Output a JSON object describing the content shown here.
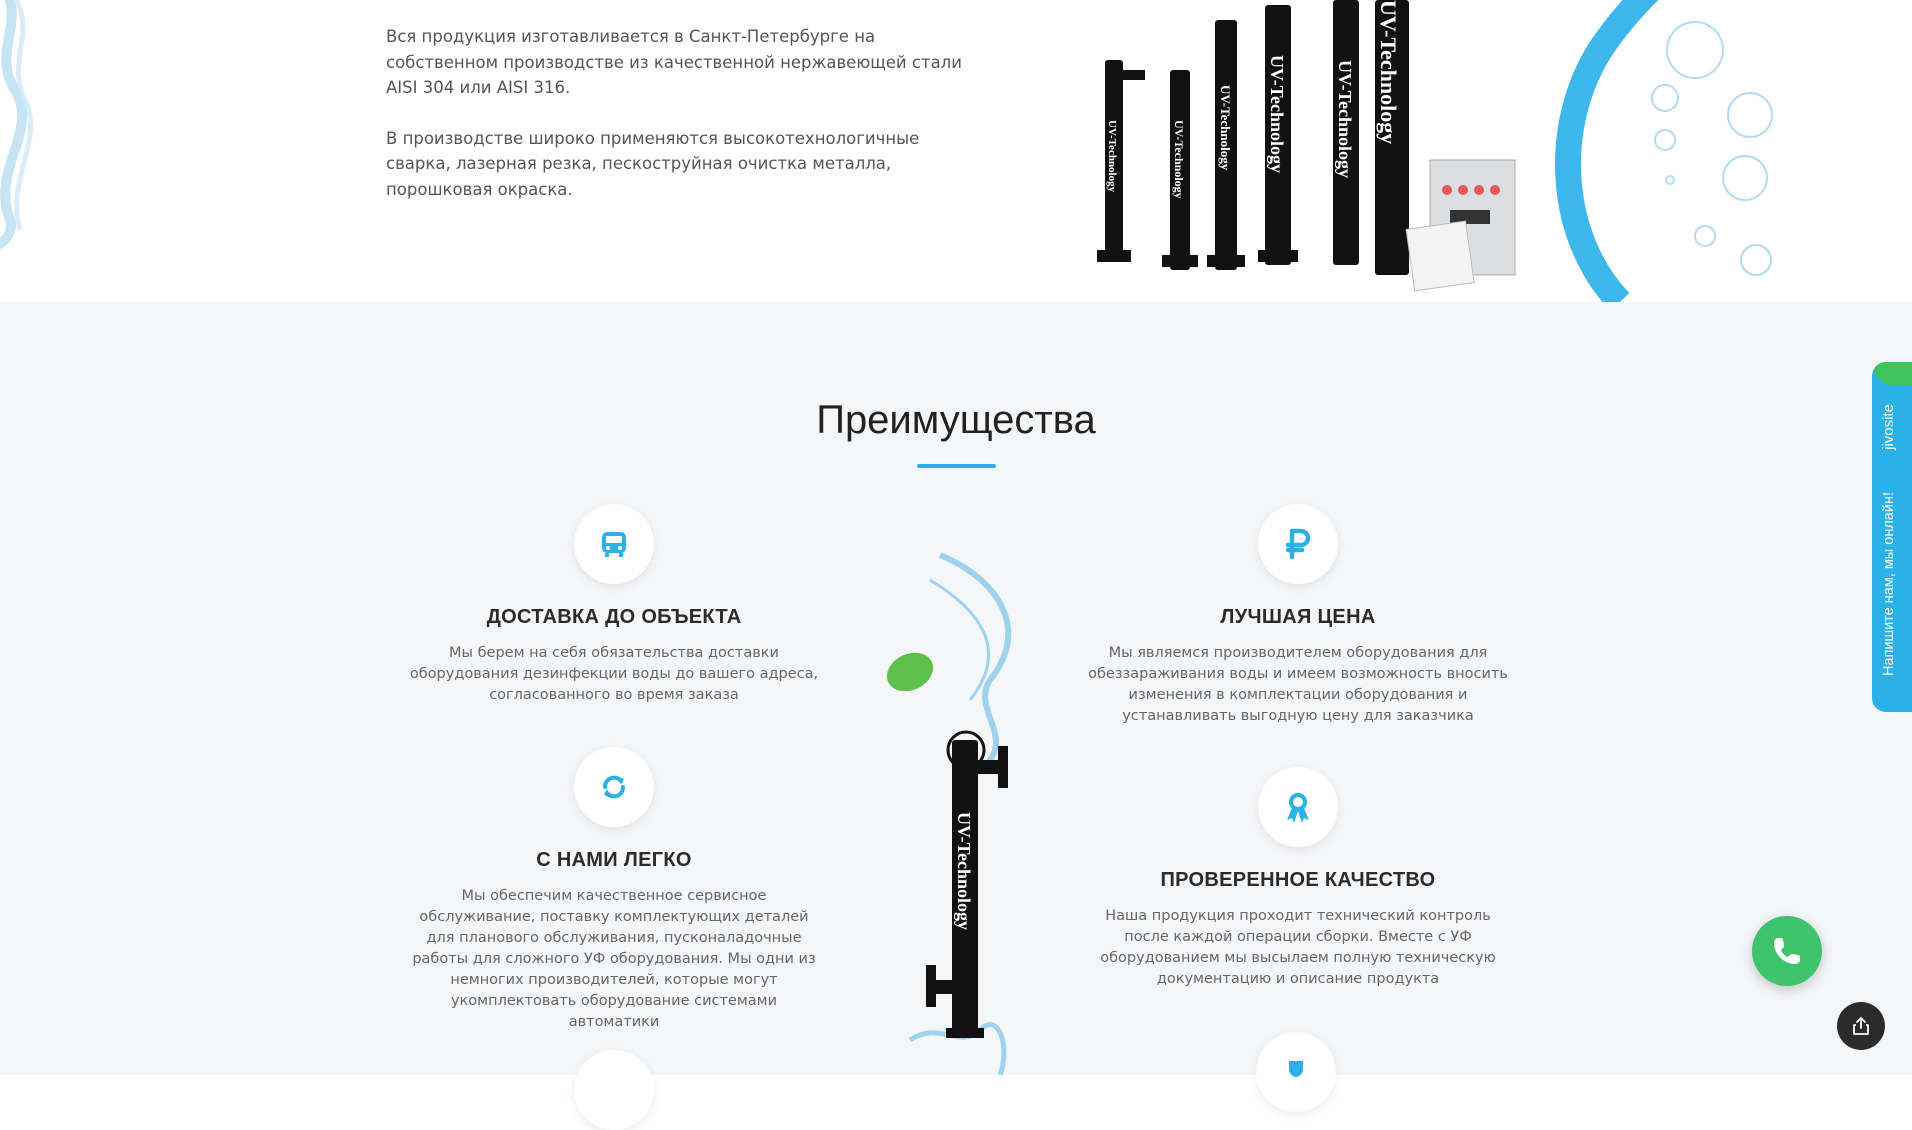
{
  "about": {
    "paragraph1": "Вся продукция изготавливается в Санкт-Петербурге на собственном производстве из качественной нержавеющей стали AISI 304 или AISI 316.",
    "paragraph2": "В производстве широко применяются высокотехнологичные сварка, лазерная резка, пескоструйная очистка металла, порошковая окраска."
  },
  "products_image": {
    "label": "UV-Technology"
  },
  "advantages": {
    "title": "Преимущества",
    "items": [
      {
        "icon": "bus-icon",
        "title": "ДОСТАВКА ДО ОБЪЕКТА",
        "text": "Мы берем на себя обязательства доставки оборудования дезинфекции воды до вашего адреса, согласованного во время заказа"
      },
      {
        "icon": "ruble-icon",
        "title": "ЛУЧШАЯ ЦЕНА",
        "text": "Мы являемся производителем оборудования для обеззараживания воды и имеем возможность вносить изменения в комплектации оборудования и устанавливать выгодную цену для заказчика"
      },
      {
        "icon": "refresh-icon",
        "title": "С НАМИ ЛЕГКО",
        "text": "Мы обеспечим качественное сервисное обслуживание, поставку комплектующих деталей для планового обслуживания, пусконаладочные работы для сложного УФ оборудования. Мы одни из немногих производителей, которые могут укомплектовать оборудование системами автоматики"
      },
      {
        "icon": "award-icon",
        "title": "ПРОВЕРЕННОЕ КАЧЕСТВО",
        "text": "Наша продукция проходит технический контроль после каждой операции сборки. Вместе с УФ оборудованием мы высылаем полную техническую документацию и описание продукта"
      }
    ]
  },
  "chat_widget": {
    "brand": "jivosite",
    "message": "Напишите нам, мы онлайн!"
  },
  "colors": {
    "accent": "#2ab2e8",
    "call_green": "#3ec46d",
    "section_bg": "#f5f6f8"
  }
}
